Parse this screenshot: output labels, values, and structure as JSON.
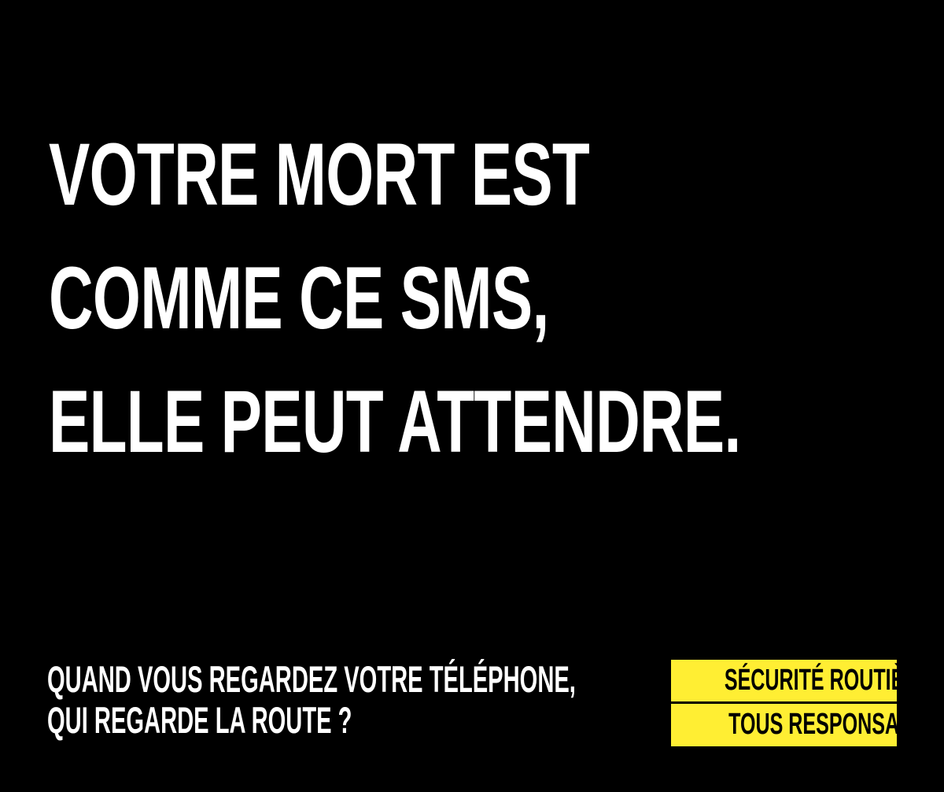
{
  "colors": {
    "background": "#000000",
    "text": "#ffffff",
    "brand_background": "#ffee33",
    "brand_text": "#000000"
  },
  "headline": {
    "lines": [
      "VOTRE MORT EST",
      "COMME CE SMS,",
      "ELLE PEUT ATTENDRE."
    ]
  },
  "tagline": {
    "lines": [
      "QUAND VOUS REGARDEZ VOTRE TÉLÉPHONE,",
      "QUI REGARDE LA ROUTE ?"
    ]
  },
  "brand": {
    "name": "SÉCURITÉ ROUTIÈRE",
    "slogan": "TOUS RESPONSABLES"
  }
}
